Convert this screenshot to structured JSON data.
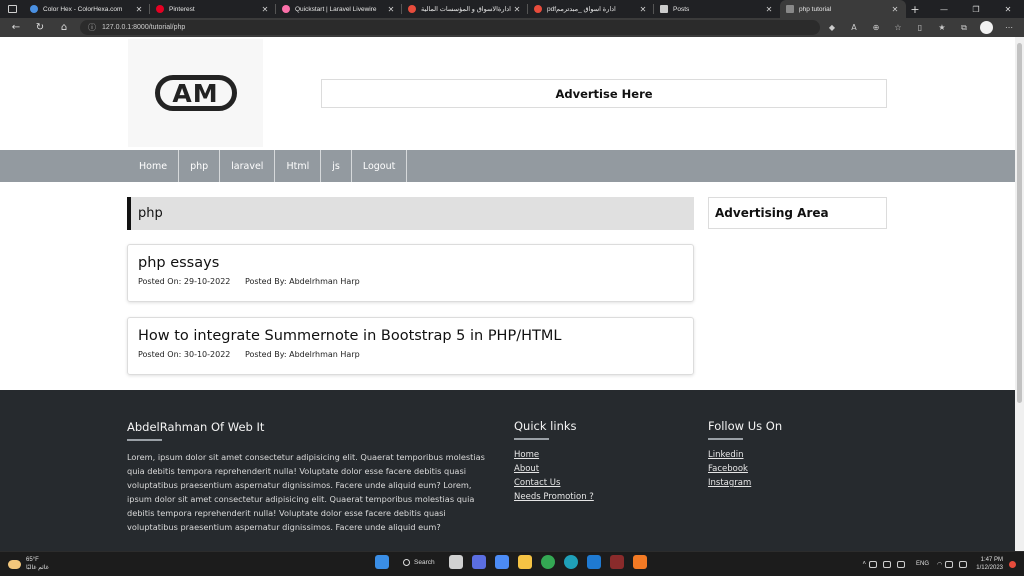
{
  "browser": {
    "tabs": [
      {
        "title": "Color Hex - ColorHexa.com",
        "color": "#4a90e2",
        "active": false
      },
      {
        "title": "Pinterest",
        "color": "#e60023",
        "active": false
      },
      {
        "title": "Quickstart | Laravel Livewire",
        "color": "#fb70a9",
        "active": false
      },
      {
        "title": "ادارةالاسواق و المؤسسات المالية",
        "color": "#e74c3c",
        "active": false
      },
      {
        "title": "pdfادارة اسواق _مبدترمم",
        "color": "#e74c3c",
        "active": false
      },
      {
        "title": "Posts",
        "color": "#cccccc",
        "active": false
      },
      {
        "title": "php tutorial",
        "color": "#888888",
        "active": true
      }
    ],
    "url": "127.0.0.1:8000/tutorial/php"
  },
  "header": {
    "logo_text": "AM",
    "advertise_label": "Advertise Here"
  },
  "nav": {
    "items": [
      "Home",
      "php",
      "laravel",
      "Html",
      "js",
      "Logout"
    ]
  },
  "main": {
    "category_title": "php",
    "posts": [
      {
        "title": "php essays",
        "posted_on": "Posted On: 29-10-2022",
        "posted_by": "Posted By: Abdelrhman Harp"
      },
      {
        "title": "How to integrate Summernote in Bootstrap 5 in PHP/HTML",
        "posted_on": "Posted On: 30-10-2022",
        "posted_by": "Posted By: Abdelrhman Harp"
      }
    ],
    "sidebar_ad": "Advertising Area"
  },
  "footer": {
    "about_title": "AbdelRahman Of Web It",
    "about_text": "Lorem, ipsum dolor sit amet consectetur adipisicing elit. Quaerat temporibus molestias quia debitis tempora reprehenderit nulla! Voluptate dolor esse facere debitis quasi voluptatibus praesentium aspernatur dignissimos. Facere unde aliquid eum? Lorem, ipsum dolor sit amet consectetur adipisicing elit. Quaerat temporibus molestias quia debitis tempora reprehenderit nulla! Voluptate dolor esse facere debitis quasi voluptatibus praesentium aspernatur dignissimos. Facere unde aliquid eum?",
    "quick_links_title": "Quick links",
    "quick_links": [
      "Home",
      "About",
      "Contact Us",
      "Needs Promotion ?"
    ],
    "follow_title": "Follow Us On",
    "follow_links": [
      "Linkedin",
      "Facebook",
      "Instagram"
    ]
  },
  "taskbar": {
    "weather_temp": "65°F",
    "weather_desc": "غائم غالبًا",
    "search_label": "Search",
    "language": "ENG",
    "time": "1:47 PM",
    "date": "1/12/2023"
  }
}
